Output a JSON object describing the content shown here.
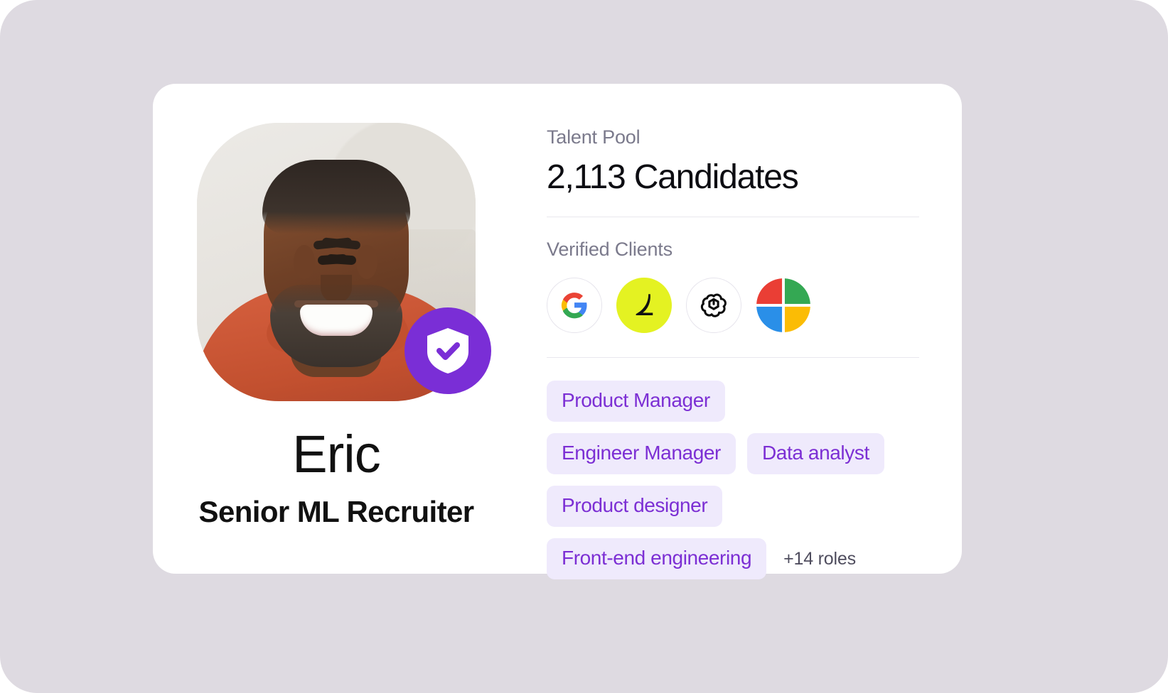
{
  "theme": {
    "page_background": "#dedae1",
    "card_background": "#ffffff",
    "accent_purple": "#7a2ed6",
    "tag_background": "#efeafc",
    "tag_text": "#7c2fd4",
    "muted_text": "#7b7a8c",
    "divider": "#e9e7ee",
    "lime": "#e4f222"
  },
  "profile": {
    "name": "Eric",
    "role": "Senior ML Recruiter",
    "photo_alt": "smiling man in orange shirt",
    "verified_badge_icon": "shield-check-icon"
  },
  "talent_pool": {
    "label": "Talent Pool",
    "count_text": "2,113 Candidates",
    "count": 2113
  },
  "verified_clients": {
    "label": "Verified Clients",
    "logos": [
      {
        "name": "google-logo",
        "style": "outlined"
      },
      {
        "name": "lime-brand-logo",
        "style": "lime"
      },
      {
        "name": "openai-logo",
        "style": "outlined"
      },
      {
        "name": "microsoft-logo",
        "style": "plain"
      }
    ]
  },
  "roles": {
    "tags": [
      "Product Manager",
      "Engineer Manager",
      "Data analyst",
      "Product designer",
      "Front-end engineering"
    ],
    "more_label": "+14 roles"
  }
}
